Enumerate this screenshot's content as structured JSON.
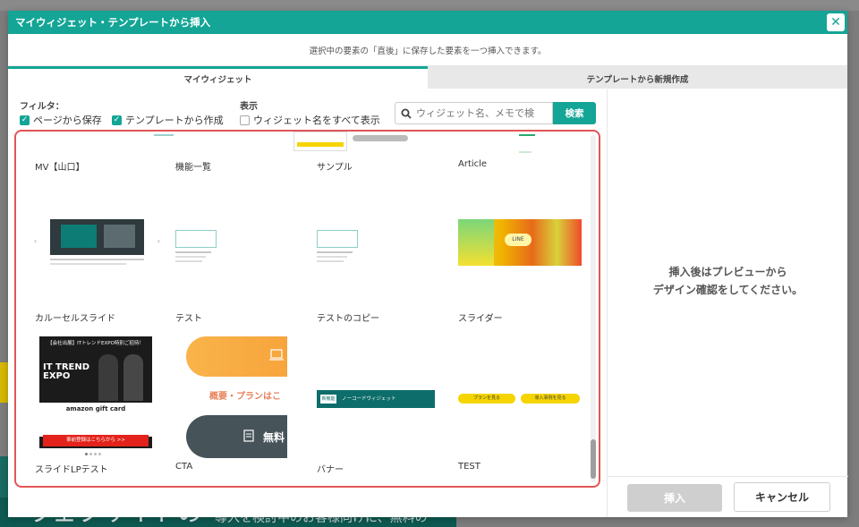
{
  "dialog": {
    "title": "マイウィジェット・テンプレートから挿入",
    "close_icon": "close-icon",
    "subtitle": "選択中の要素の「直後」に保存した要素を一つ挿入できます。"
  },
  "tabs": [
    {
      "label": "マイウィジェット",
      "active": true
    },
    {
      "label": "テンプレートから新規作成",
      "active": false
    }
  ],
  "filters": {
    "filter_label": "フィルタ：",
    "display_label": "表示",
    "options": [
      {
        "label": "ページから保存",
        "checked": true
      },
      {
        "label": "テンプレートから作成",
        "checked": true
      },
      {
        "label": "ウィジェット名をすべて表示",
        "checked": false
      }
    ]
  },
  "search": {
    "placeholder": "ウィジェット名、メモで検",
    "button_label": "検索",
    "icon": "search-icon"
  },
  "widgets_row1": [
    {
      "name": "MV【山口】"
    },
    {
      "name": "機能一覧"
    },
    {
      "name": "サンプル"
    },
    {
      "name": "Article"
    }
  ],
  "widgets_row2": [
    {
      "name": "カルーセルスライド"
    },
    {
      "name": "テスト"
    },
    {
      "name": "テストのコピー"
    },
    {
      "name": "スライダー"
    }
  ],
  "widgets_row3": [
    {
      "name": "スライドLPテスト"
    },
    {
      "name": "CTA"
    },
    {
      "name": "バナー"
    },
    {
      "name": "TEST"
    }
  ],
  "thumb_text": {
    "expo_header": "【会社出展】ITトレンドEXPO特別ご招待！",
    "expo_title": "IT TREND EXPO",
    "amazon": "amazon gift card",
    "cta_red": "事前登録はこちらから >>",
    "cta_text": "概要・プランはこ",
    "cta_free": "無料",
    "banner_tag": "新機能",
    "banner_text": "ノーコードウィジェット",
    "test_btn1": "プランを見る",
    "test_btn2": "導入事例を見る",
    "slider_line": "LINE"
  },
  "right_panel": {
    "message_line1": "挿入後はプレビューから",
    "message_line2": "デザイン確認をしてください。",
    "insert_label": "挿入",
    "cancel_label": "キャンセル"
  },
  "background": {
    "bottom_text": "導入を検討中のお客様向けに、無料の",
    "bottom_left": "ウェブサイトの"
  },
  "colors": {
    "accent": "#14a596",
    "highlight_border": "#e25555",
    "disabled_button": "#cfcfcf"
  }
}
